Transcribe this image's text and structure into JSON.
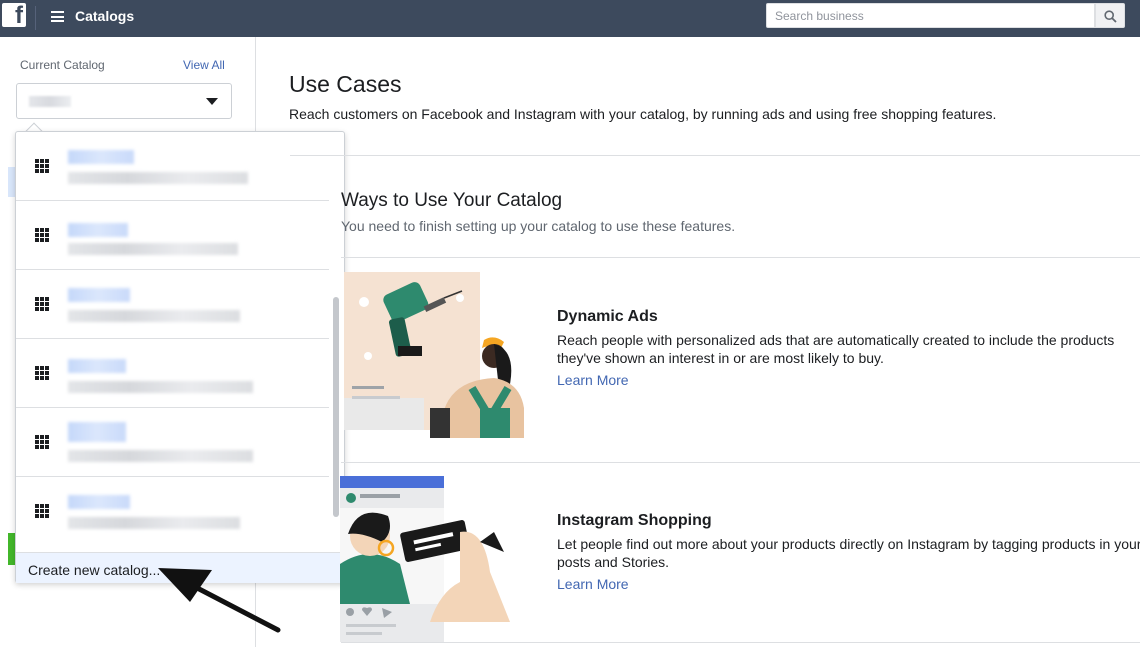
{
  "topbar": {
    "logo": "f",
    "title": "Catalogs",
    "search_placeholder": "Search business",
    "icons": [
      "facebook-logo",
      "hamburger-menu-icon",
      "search-icon"
    ]
  },
  "sidebar": {
    "current_catalog_label": "Current Catalog",
    "view_all": "View All"
  },
  "dropdown": {
    "items": [
      {
        "icon": "grid-icon"
      },
      {
        "icon": "grid-icon"
      },
      {
        "icon": "grid-icon"
      },
      {
        "icon": "grid-icon"
      },
      {
        "icon": "grid-icon"
      },
      {
        "icon": "grid-icon"
      }
    ],
    "create_new": "Create new catalog..."
  },
  "main": {
    "title": "Use Cases",
    "description": "Reach customers on Facebook and Instagram with your catalog, by running ads and using free shopping features.",
    "section_title": "Ways to Use Your Catalog",
    "section_desc": "You need to finish setting up your catalog to use these features.",
    "features": [
      {
        "title": "Dynamic Ads",
        "desc": "Reach people with personalized ads that are automatically created to include the products they've shown an interest in or are most likely to buy.",
        "link": "Learn More"
      },
      {
        "title": "Instagram Shopping",
        "desc": "Let people find out more about your products directly on Instagram by tagging products in your posts and Stories.",
        "link": "Learn More"
      }
    ]
  },
  "colors": {
    "topbar": "#3d4a5d",
    "link": "#4267b2",
    "dropdown_footer": "#ecf3ff"
  }
}
